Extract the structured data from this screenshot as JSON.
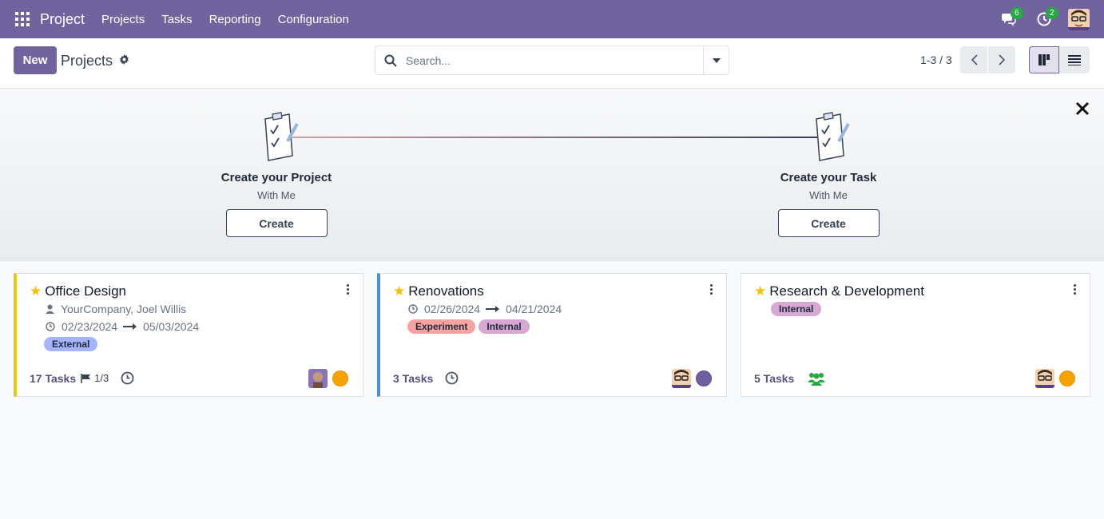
{
  "navbar": {
    "brand": "Project",
    "menu": [
      "Projects",
      "Tasks",
      "Reporting",
      "Configuration"
    ],
    "messages_badge": "6",
    "activities_badge": "2"
  },
  "control_panel": {
    "new_label": "New",
    "title": "Projects",
    "search_placeholder": "Search...",
    "pager": "1-3 / 3"
  },
  "onboarding": {
    "step1": {
      "title": "Create your Project",
      "subtitle": "With Me",
      "button": "Create"
    },
    "step2": {
      "title": "Create your Task",
      "subtitle": "With Me",
      "button": "Create"
    }
  },
  "cards": [
    {
      "title": "Office Design",
      "partner": "YourCompany, Joel Willis",
      "date_start": "02/23/2024",
      "date_end": "05/03/2024",
      "tags": [
        "External"
      ],
      "tasks": "17 Tasks",
      "milestones": "1/3",
      "border_color": "#f0c419",
      "status_color": "#f7a305"
    },
    {
      "title": "Renovations",
      "date_start": "02/26/2024",
      "date_end": "04/21/2024",
      "tags": [
        "Experiment",
        "Internal"
      ],
      "tasks": "3 Tasks",
      "border_color": "#4a90d9",
      "status_color": "#6e5fa0"
    },
    {
      "title": "Research & Development",
      "tags": [
        "Internal"
      ],
      "tasks": "5 Tasks",
      "status_color": "#f7a305"
    }
  ],
  "colors": {
    "brand": "#71639e",
    "tag_external": "#a5b4fc",
    "tag_experiment": "#f8a3a3",
    "tag_internal": "#d7a8d3"
  }
}
